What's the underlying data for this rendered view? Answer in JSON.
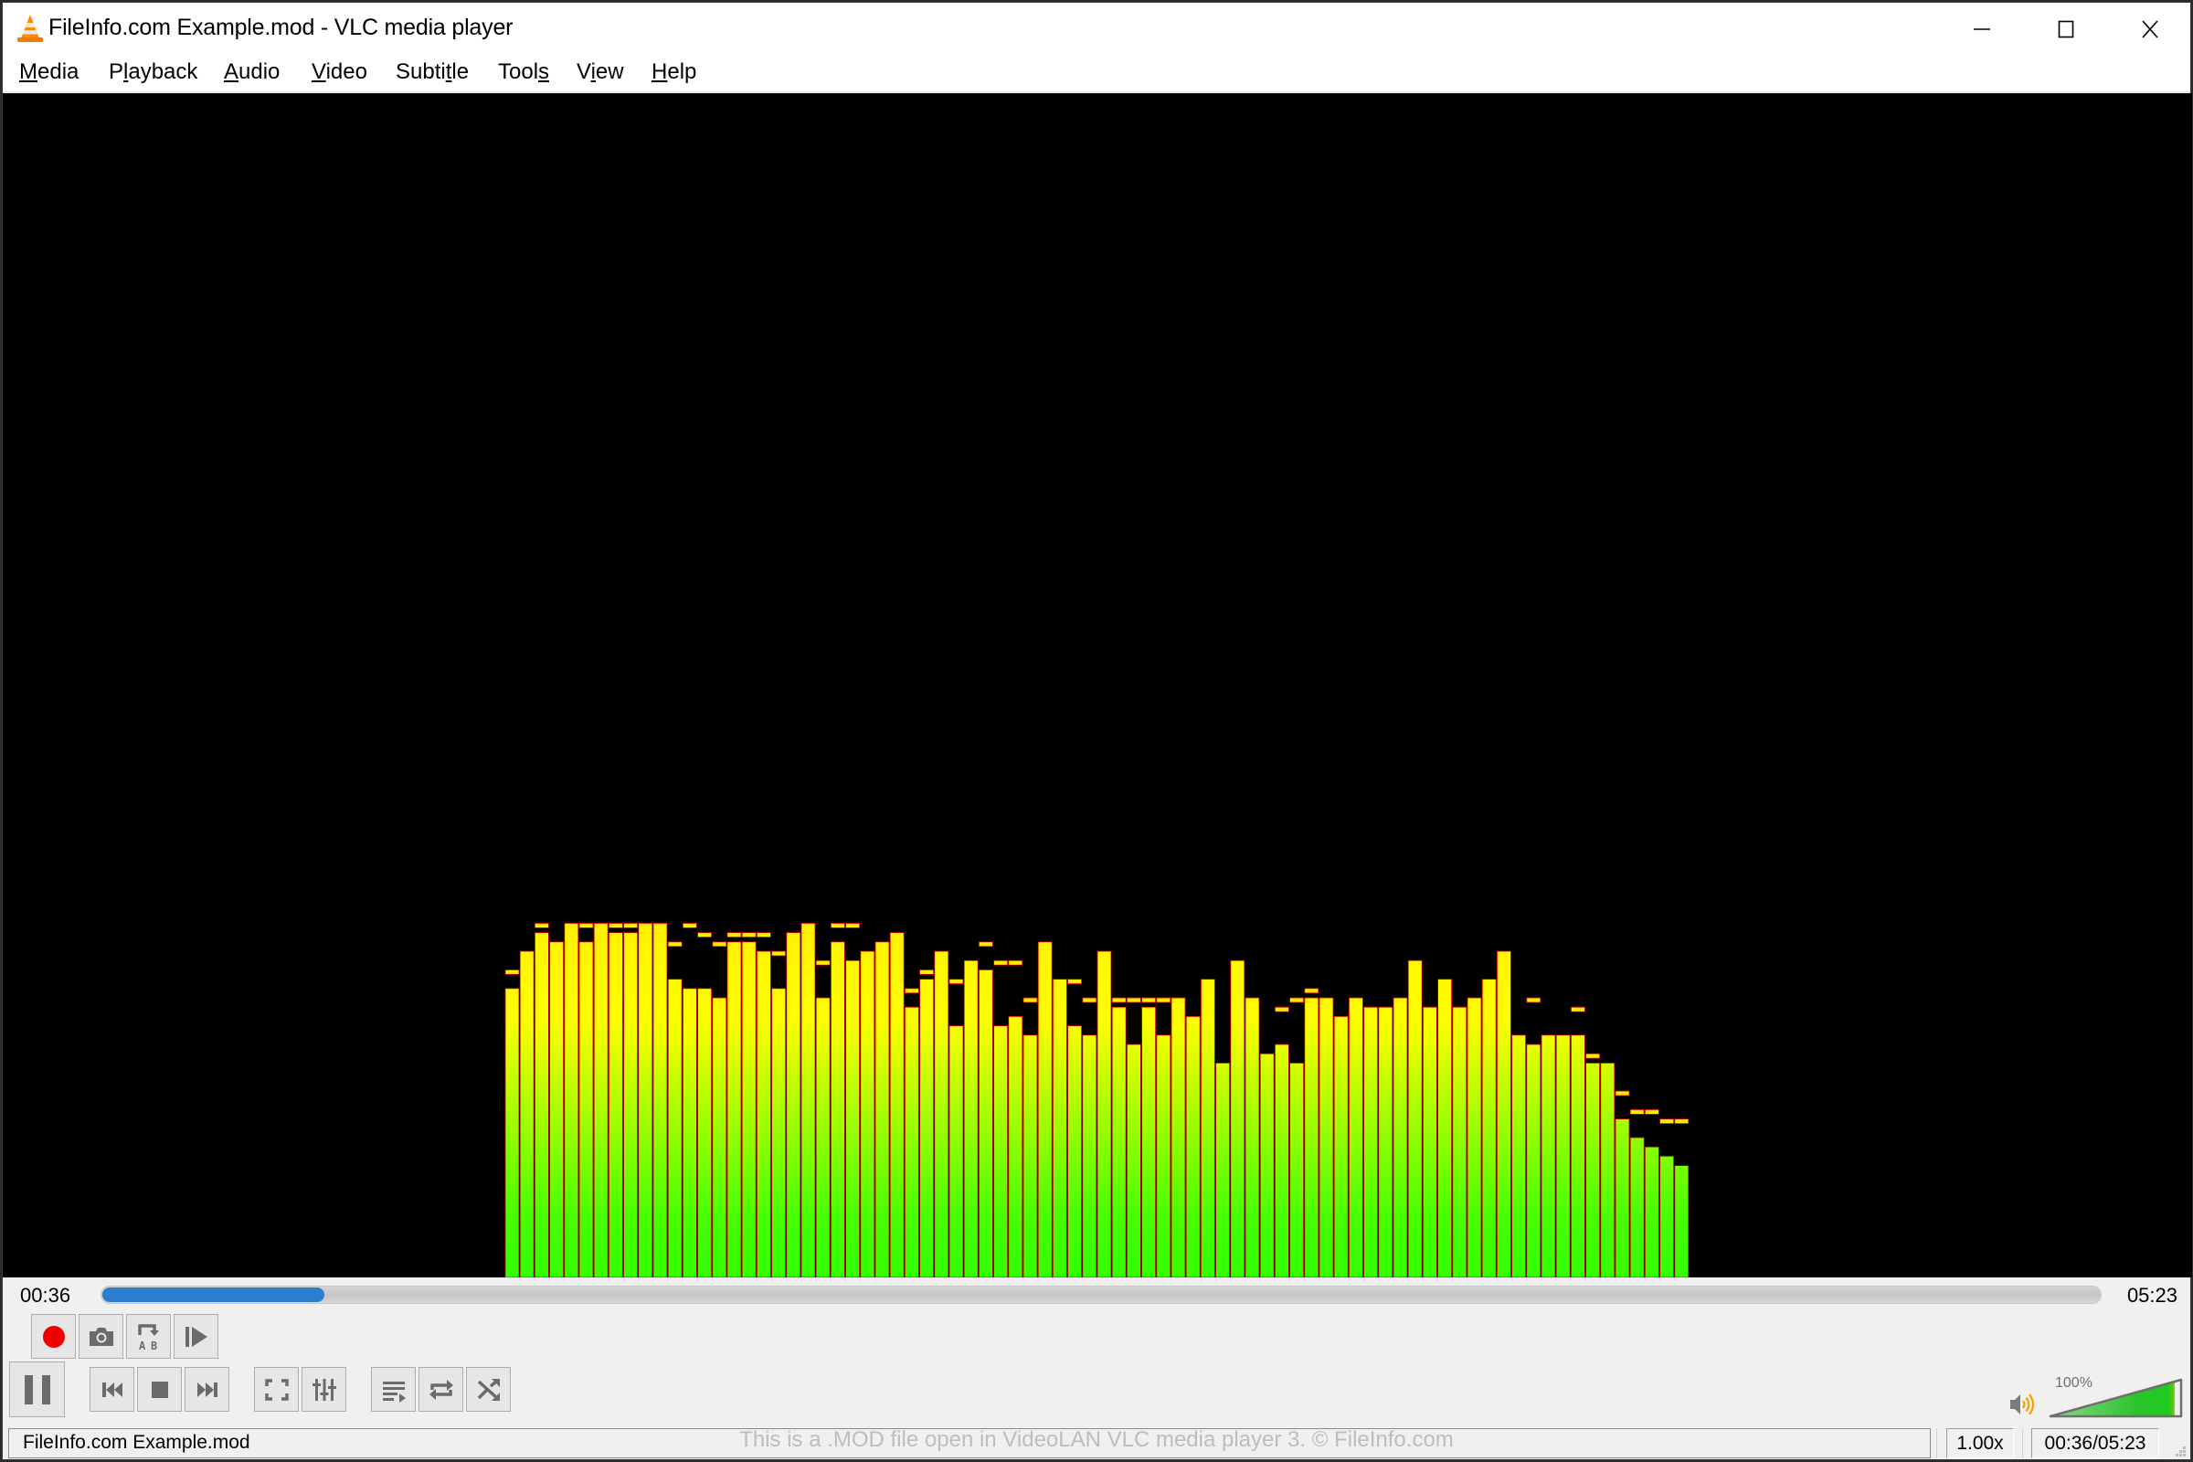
{
  "window": {
    "title": "FileInfo.com Example.mod - VLC media player",
    "controls": [
      "minimize",
      "maximize",
      "close"
    ]
  },
  "menu": [
    {
      "label": "Media",
      "accel_index": 0
    },
    {
      "label": "Playback",
      "accel_index": 1
    },
    {
      "label": "Audio",
      "accel_index": 0
    },
    {
      "label": "Video",
      "accel_index": 0
    },
    {
      "label": "Subtitle",
      "accel_index": 5
    },
    {
      "label": "Tools",
      "accel_index": 4
    },
    {
      "label": "View",
      "accel_index": 1
    },
    {
      "label": "Help",
      "accel_index": 0
    }
  ],
  "visualizer": {
    "type": "spectrum",
    "bar_count": 80,
    "levels": [
      0.31,
      0.35,
      0.37,
      0.36,
      0.38,
      0.36,
      0.38,
      0.37,
      0.37,
      0.38,
      0.38,
      0.32,
      0.31,
      0.31,
      0.3,
      0.36,
      0.36,
      0.35,
      0.31,
      0.37,
      0.38,
      0.3,
      0.36,
      0.34,
      0.35,
      0.36,
      0.37,
      0.29,
      0.32,
      0.35,
      0.27,
      0.34,
      0.33,
      0.27,
      0.28,
      0.26,
      0.36,
      0.32,
      0.27,
      0.26,
      0.35,
      0.29,
      0.25,
      0.29,
      0.26,
      0.3,
      0.28,
      0.32,
      0.23,
      0.34,
      0.3,
      0.24,
      0.25,
      0.23,
      0.3,
      0.3,
      0.28,
      0.3,
      0.29,
      0.29,
      0.3,
      0.34,
      0.29,
      0.32,
      0.29,
      0.3,
      0.32,
      0.35,
      0.26,
      0.25,
      0.26,
      0.26,
      0.26,
      0.23,
      0.23,
      0.17,
      0.15,
      0.14,
      0.13,
      0.12
    ],
    "peaks": [
      0.33,
      0.34,
      0.38,
      0.36,
      0.38,
      0.38,
      0.38,
      0.38,
      0.38,
      0.38,
      0.38,
      0.36,
      0.38,
      0.37,
      0.36,
      0.37,
      0.37,
      0.37,
      0.35,
      0.37,
      0.38,
      0.34,
      0.38,
      0.38,
      0.35,
      0.36,
      0.37,
      0.31,
      0.33,
      0.35,
      0.32,
      0.34,
      0.36,
      0.34,
      0.34,
      0.3,
      0.36,
      0.32,
      0.32,
      0.3,
      0.35,
      0.3,
      0.3,
      0.3,
      0.3,
      0.28,
      0.28,
      0.3,
      0.23,
      0.31,
      0.3,
      0.24,
      0.29,
      0.3,
      0.31,
      0.3,
      0.28,
      0.3,
      0.29,
      0.29,
      0.3,
      0.34,
      0.29,
      0.32,
      0.29,
      0.3,
      0.32,
      0.35,
      0.26,
      0.3,
      0.26,
      0.26,
      0.29,
      0.24,
      0.23,
      0.2,
      0.18,
      0.18,
      0.17,
      0.17
    ]
  },
  "playback": {
    "elapsed": "00:36",
    "total": "05:23",
    "progress": 0.111
  },
  "controls": {
    "record": "Record",
    "snapshot": "Take a snapshot",
    "ab_loop": "Loop from point A to point B continuously",
    "frame_step": "Frame by frame",
    "pause": "Pause the playback",
    "previous": "Previous media in the playlist",
    "stop": "Stop playback",
    "next": "Next media in the playlist",
    "fullscreen": "Toggle the video in fullscreen",
    "extended_settings": "Show extended settings",
    "playlist": "Toggle playlist",
    "loop": "Click to toggle between loop all, loop one and no loop",
    "random": "Random"
  },
  "volume": {
    "label": "100%",
    "level": 1.0
  },
  "status": {
    "filename": "FileInfo.com Example.mod",
    "watermark": "This is a .MOD file open in VideoLAN VLC media player 3. © FileInfo.com",
    "speed": "1.00x",
    "time": "00:36/05:23"
  },
  "colors": {
    "accent": "#2c7fd0",
    "record": "#ee0000",
    "icon": "#6b6b6b",
    "volume_fill": "#22c922",
    "speaker_waves": "#ff9900"
  }
}
